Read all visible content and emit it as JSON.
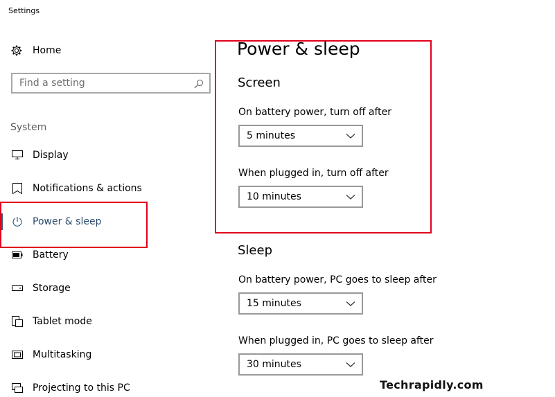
{
  "window": {
    "title": "Settings"
  },
  "sidebar": {
    "home_label": "Home",
    "search_placeholder": "Find a setting",
    "group_label": "System",
    "items": [
      {
        "label": "Display",
        "icon": "monitor-icon"
      },
      {
        "label": "Notifications & actions",
        "icon": "notifications-icon"
      },
      {
        "label": "Power & sleep",
        "icon": "power-icon",
        "selected": true
      },
      {
        "label": "Battery",
        "icon": "battery-icon"
      },
      {
        "label": "Storage",
        "icon": "storage-icon"
      },
      {
        "label": "Tablet mode",
        "icon": "tablet-icon"
      },
      {
        "label": "Multitasking",
        "icon": "multitasking-icon"
      },
      {
        "label": "Projecting to this PC",
        "icon": "projecting-icon"
      }
    ]
  },
  "main": {
    "title": "Power & sleep",
    "screen": {
      "heading": "Screen",
      "battery_label": "On battery power, turn off after",
      "battery_value": "5 minutes",
      "plugged_label": "When plugged in, turn off after",
      "plugged_value": "10 minutes"
    },
    "sleep": {
      "heading": "Sleep",
      "battery_label": "On battery power, PC goes to sleep after",
      "battery_value": "15 minutes",
      "plugged_label": "When plugged in, PC goes to sleep after",
      "plugged_value": "30 minutes"
    }
  },
  "watermark": "Techrapidly.com",
  "colors": {
    "highlight": "#e0001b",
    "selected_text": "#2a4a6b",
    "selected_bar": "#3a5a80"
  }
}
